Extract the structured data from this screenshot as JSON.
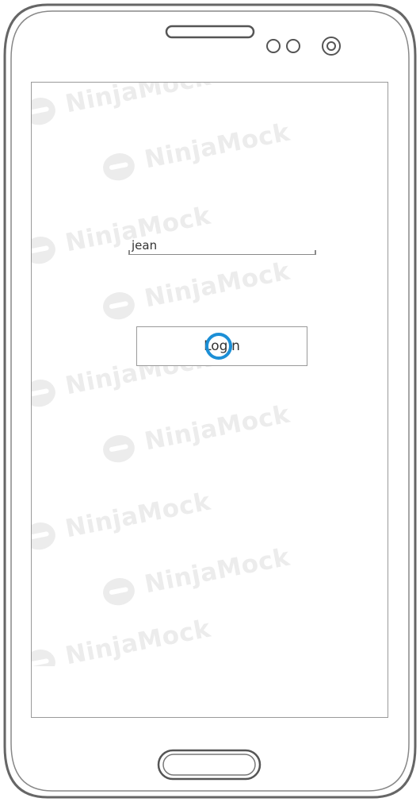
{
  "watermark": {
    "text": "NinjaMock"
  },
  "login_form": {
    "username_value": "jean",
    "login_button_label": "Login"
  },
  "colors": {
    "click_marker": "#1c8fd6",
    "outline": "#9a9a9a",
    "watermark": "#ececec"
  }
}
